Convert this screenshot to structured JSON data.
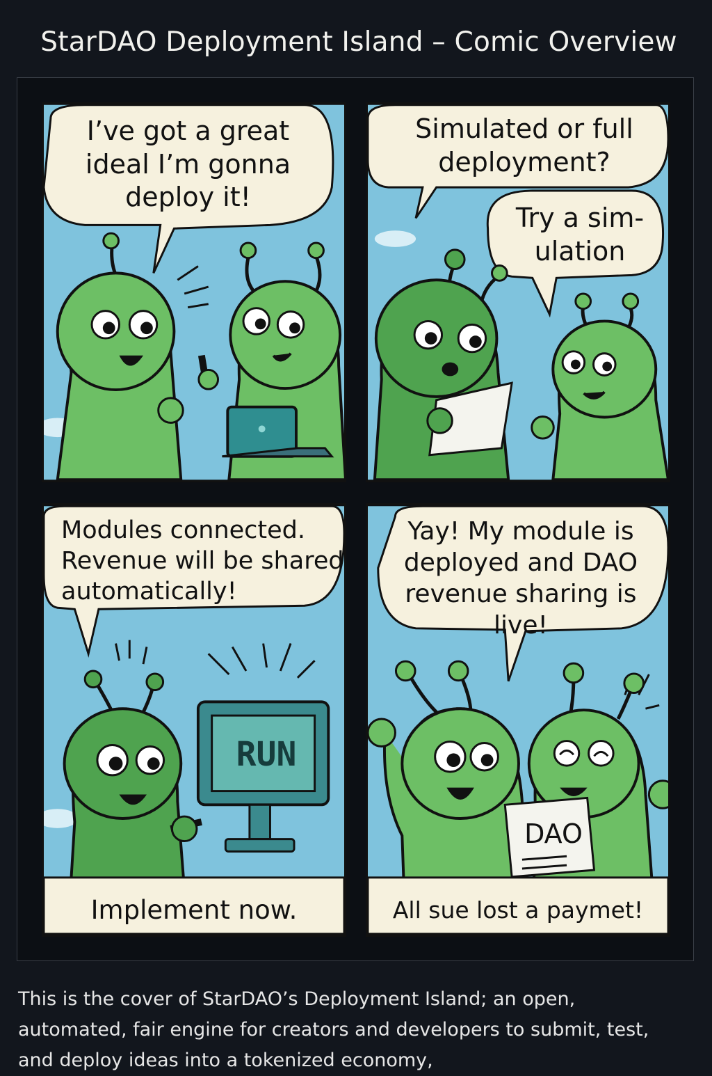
{
  "header": {
    "title": "StarDAO Deployment Island – Comic Overview"
  },
  "panels": [
    {
      "bubbles": [
        "I’ve got a great ideal I’m gonna deploy it!"
      ]
    },
    {
      "bubbles": [
        "Simulated or full deployment?",
        "Try a sim-ulation"
      ]
    },
    {
      "bubbles": [
        "Modules connected. Revenue will be shared automatically!"
      ],
      "screen_label": "RUN",
      "caption": "Implement now."
    },
    {
      "bubbles": [
        "Yay! My module is deployed and DAO revenue sharing is live!"
      ],
      "sign_label": "DAO",
      "caption": "All sue lost a paymet!"
    }
  ],
  "description": "This is the cover of StarDAO’s Deployment Island; an open, automated, fair engine for creators and developers to submit, test, and deploy ideas into a tokenized economy,",
  "colors": {
    "sky": "#7fc3dd",
    "alien": "#6dbf65",
    "alien_dark": "#4fa34f",
    "bubble": "#f6f1de",
    "outline": "#111111"
  }
}
